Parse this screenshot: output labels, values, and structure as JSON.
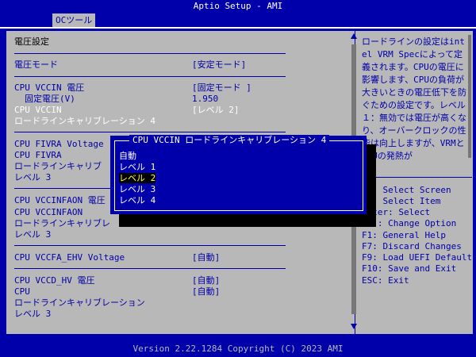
{
  "title": "Aptio Setup - AMI",
  "tab": "OCツール",
  "footer": "Version 2.22.1284 Copyright (C) 2023 AMI",
  "section_heading": "電圧設定",
  "rows": {
    "voltage_mode": {
      "label": "電圧モード",
      "value": "[安定モード]"
    },
    "vccin_voltage": {
      "label": "CPU VCCIN 電圧",
      "value": "[固定モード ]"
    },
    "fixed_voltage": {
      "label": "固定電圧(V)",
      "value": "1.950"
    },
    "vccin": {
      "label": "CPU VCCIN",
      "value": "[レベル 2]"
    },
    "vccin_llc": {
      "label": "ロードラインキャリブレーション 4"
    },
    "fivra_voltage": {
      "label": "CPU FIVRA Voltage"
    },
    "fivra": {
      "label": "CPU FIVRA"
    },
    "fivra_llc": {
      "label": "ロードラインキャリブ"
    },
    "fivra_level": {
      "label": "レベル 3"
    },
    "vccinfaon_voltage": {
      "label": "CPU VCCINFAON 電圧"
    },
    "vccinfaon": {
      "label": "CPU VCCINFAON"
    },
    "vccinfaon_llc": {
      "label": "ロードラインキャリブレ"
    },
    "vccinfaon_level": {
      "label": "レベル 3"
    },
    "vccfa_ehv": {
      "label": "CPU VCCFA_EHV Voltage",
      "value": "[自動]"
    },
    "vccd_hv_voltage": {
      "label": "CPU VCCD_HV 電圧",
      "value": "[自動]"
    },
    "cpu": {
      "label": "CPU",
      "value": "[自動]"
    },
    "cpu_llc": {
      "label": "ロードラインキャリブレーション"
    },
    "cpu_level": {
      "label": "レベル 3"
    }
  },
  "dialog": {
    "title": "CPU VCCIN ロードラインキャリブレーション 4",
    "options": [
      "自動",
      "レベル 1",
      "レベル 2",
      "レベル 3",
      "レベル 4"
    ],
    "selected": "レベル 2"
  },
  "help": {
    "text": "ロードラインの設定はintel VRM Specによって定義されます。CPUの電圧に影響します、CPUの負荷が大きいときの電圧低下を防ぐための設定です。レベル１：無効では電圧が高くなり、オーバークロックの性能は向上しますが、VRMとCPUの発熱が",
    "keys": [
      "→←: Select Screen",
      "↑↓: Select Item",
      "Enter: Select",
      "+/-: Change Option",
      "F1: General Help",
      "F7: Discard Changes",
      "F9: Load UEFI Defaults",
      "F10: Save and Exit",
      "ESC: Exit"
    ]
  },
  "colors": {
    "bios_blue": "#0000aa",
    "panel_gray": "#b8b8b8",
    "highlight_yellow": "#ffff55"
  }
}
